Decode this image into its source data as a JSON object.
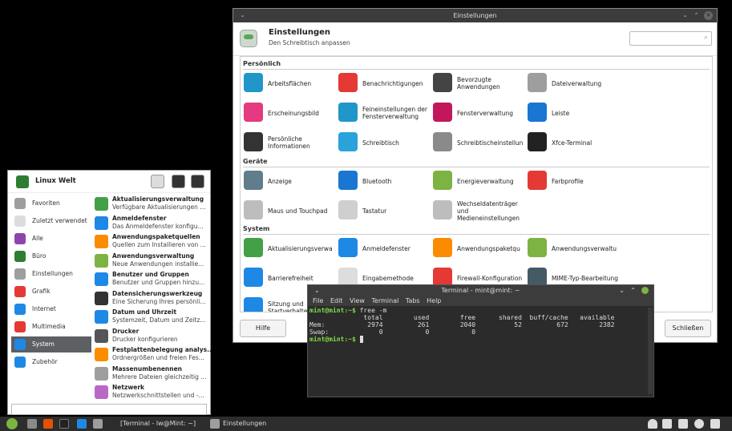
{
  "settings": {
    "window_title": "Einstellungen",
    "header_title": "Einstellungen",
    "header_subtitle": "Den Schreibtisch anpassen",
    "search_icon": "search-icon",
    "sections": [
      {
        "title": "Persönlich",
        "items": [
          {
            "label": "Arbeitsflächen",
            "color": "#2196c9"
          },
          {
            "label": "Benachrichtigungen",
            "color": "#e53935"
          },
          {
            "label": "Bevorzugte Anwendungen",
            "color": "#444444"
          },
          {
            "label": "Dateiverwaltung",
            "color": "#9e9e9e"
          },
          {
            "label": "Erscheinungsbild",
            "color": "#e53980"
          },
          {
            "label": "Feineinstellungen der Fensterverwaltung",
            "color": "#2196c9"
          },
          {
            "label": "Fensterverwaltung",
            "color": "#c2185b"
          },
          {
            "label": "Leiste",
            "color": "#1976d2"
          },
          {
            "label": "Persönliche Informationen",
            "color": "#333333"
          },
          {
            "label": "Schreibtisch",
            "color": "#29a3d9"
          },
          {
            "label": "Schreibtischeinstellun",
            "color": "#8a8a8a"
          },
          {
            "label": "Xfce-Terminal",
            "color": "#222222"
          }
        ]
      },
      {
        "title": "Geräte",
        "items": [
          {
            "label": "Anzeige",
            "color": "#607d8b"
          },
          {
            "label": "Bluetooth",
            "color": "#1976d2"
          },
          {
            "label": "Energieverwaltung",
            "color": "#7cb342"
          },
          {
            "label": "Farbprofile",
            "color": "#e53935"
          },
          {
            "label": "Maus und Touchpad",
            "color": "#bdbdbd"
          },
          {
            "label": "Tastatur",
            "color": "#cfcfcf"
          },
          {
            "label": "Wechseldatenträger und Medieneinstellungen",
            "color": "#bdbdbd"
          }
        ]
      },
      {
        "title": "System",
        "items": [
          {
            "label": "Aktualisierungsverwa",
            "color": "#43a047"
          },
          {
            "label": "Anmeldefenster",
            "color": "#1e88e5"
          },
          {
            "label": "Anwendungspaketqu",
            "color": "#fb8c00"
          },
          {
            "label": "Anwendungsverwaltu",
            "color": "#7cb342"
          },
          {
            "label": "Barrierefreiheit",
            "color": "#1e88e5"
          },
          {
            "label": "Eingabemethode",
            "color": "#dddddd"
          },
          {
            "label": "Firewall-Konfiguration",
            "color": "#e53935"
          },
          {
            "label": "MIME-Typ-Bearbeitung",
            "color": "#455a64"
          },
          {
            "label": "Sitzung und Startverhalte",
            "color": "#1e88e5"
          }
        ]
      }
    ],
    "help_button": "Hilfe",
    "close_button": "Schließen"
  },
  "terminal": {
    "title": "Terminal - mint@mint: ~",
    "menu": [
      "File",
      "Edit",
      "View",
      "Terminal",
      "Tabs",
      "Help"
    ],
    "prompt": "mint@mint:~$",
    "command": " free -m",
    "header": "              total        used        free      shared  buff/cache   available",
    "mem_label": "Mem:",
    "mem_values": "           2974         261        2040          52         672        2382",
    "swap_label": "Swap:",
    "swap_values": "             0           0           0",
    "prompt2": "mint@mint:~$"
  },
  "appmenu": {
    "user": "Linux Welt",
    "categories": [
      {
        "label": "Favoriten",
        "color": "#9e9e9e"
      },
      {
        "label": "Zuletzt verwendet",
        "color": "#dddddd"
      },
      {
        "label": "Alle",
        "color": "#8e44ad"
      },
      {
        "label": "Büro",
        "color": "#2e7d32"
      },
      {
        "label": "Einstellungen",
        "color": "#9e9e9e"
      },
      {
        "label": "Grafik",
        "color": "#e53935"
      },
      {
        "label": "Internet",
        "color": "#1e88e5"
      },
      {
        "label": "Multimedia",
        "color": "#e53935"
      },
      {
        "label": "System",
        "color": "#1e88e5"
      },
      {
        "label": "Zubehör",
        "color": "#1e88e5"
      }
    ],
    "apps": [
      {
        "name": "Aktualisierungsverwaltung",
        "desc": "Verfügbare Aktualisierungen ...",
        "color": "#43a047"
      },
      {
        "name": "Anmeldefenster",
        "desc": "Das Anmeldefenster konfigu...",
        "color": "#1e88e5"
      },
      {
        "name": "Anwendungspaketquellen",
        "desc": "Quellen zum Installieren von ...",
        "color": "#fb8c00"
      },
      {
        "name": "Anwendungsverwaltung",
        "desc": "Neue Anwendungen installie...",
        "color": "#7cb342"
      },
      {
        "name": "Benutzer und Gruppen",
        "desc": "Benutzer und Gruppen hinzu...",
        "color": "#1e88e5"
      },
      {
        "name": "Datensicherungswerkzeug",
        "desc": "Eine Sicherung Ihres persönli...",
        "color": "#333333"
      },
      {
        "name": "Datum und Uhrzeit",
        "desc": "Systemzeit, Datum und Zeitz...",
        "color": "#1e88e5"
      },
      {
        "name": "Drucker",
        "desc": "Drucker konfigurieren",
        "color": "#555555"
      },
      {
        "name": "Festplattenbelegung analys...",
        "desc": "Ordnergrößen und freien Fes...",
        "color": "#fb8c00"
      },
      {
        "name": "Massenumbenennen",
        "desc": "Mehrere Dateien gleichzeitig ...",
        "color": "#9e9e9e"
      },
      {
        "name": "Netzwerk",
        "desc": "Netzwerkschnittstellen und -...",
        "color": "#ba68c8"
      }
    ]
  },
  "taskbar": {
    "task_terminal": "[Terminal - lw@Mint: ~]",
    "task_settings": "Einstellungen"
  }
}
